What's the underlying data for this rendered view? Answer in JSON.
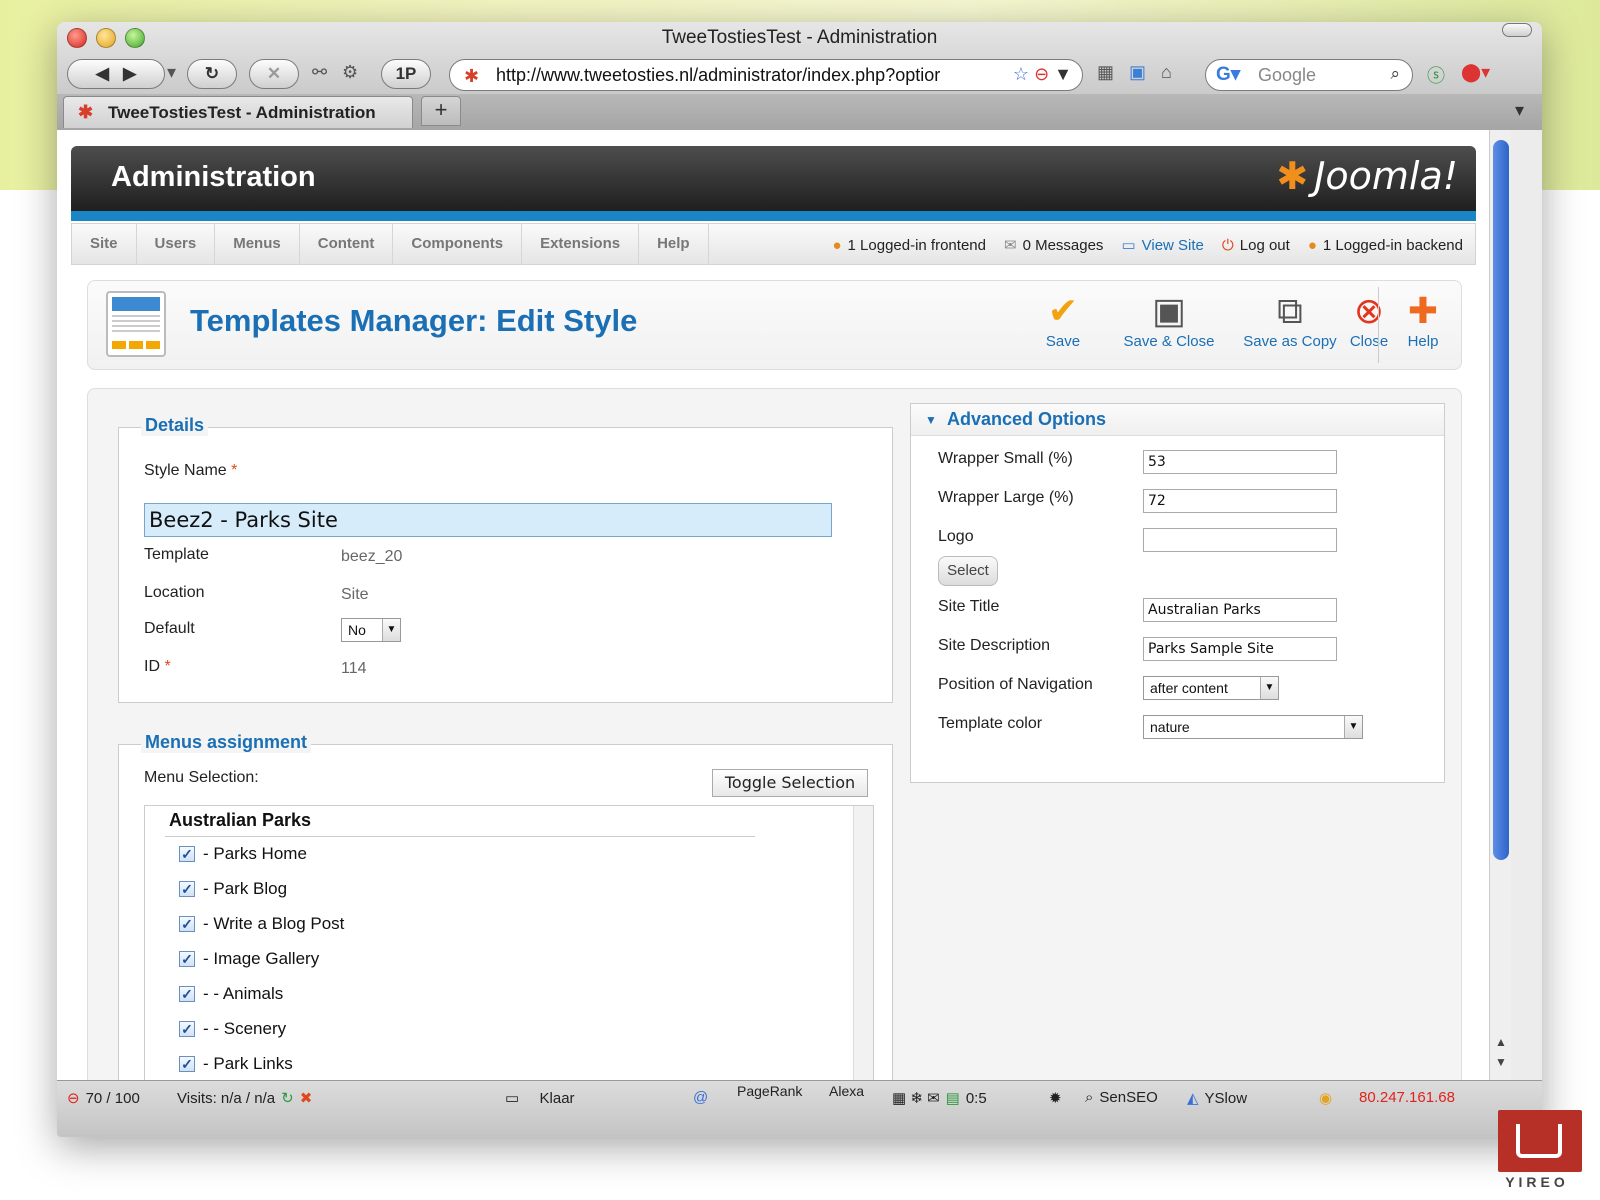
{
  "window": {
    "title": "TweeTostiesTest - Administration"
  },
  "browser": {
    "url": "http://www.tweetosties.nl/administrator/index.php?optior",
    "search_placeholder": "Google",
    "tab_title": "TweeTostiesTest - Administration",
    "new_tab": "+",
    "onep_label": "1P"
  },
  "header": {
    "title": "Administration",
    "logo": "Joomla!"
  },
  "menu": {
    "items": [
      "Site",
      "Users",
      "Menus",
      "Content",
      "Components",
      "Extensions",
      "Help"
    ],
    "status": {
      "frontend": "1 Logged-in frontend",
      "messages": "0 Messages",
      "view_site": "View Site",
      "logout": "Log out",
      "backend": "1 Logged-in backend"
    }
  },
  "toolbar": {
    "title": "Templates Manager: Edit Style",
    "save": "Save",
    "save_close": "Save & Close",
    "save_copy": "Save as Copy",
    "close": "Close",
    "help": "Help"
  },
  "details": {
    "legend": "Details",
    "style_name_label": "Style Name",
    "required_mark": "*",
    "style_name_value": "Beez2 - Parks Site",
    "template_label": "Template",
    "template_value": "beez_20",
    "location_label": "Location",
    "location_value": "Site",
    "default_label": "Default",
    "default_value": "No",
    "id_label": "ID",
    "id_value": "114"
  },
  "menus_assignment": {
    "legend": "Menus assignment",
    "menu_selection_label": "Menu Selection:",
    "toggle_button": "Toggle Selection",
    "group_title": "Australian Parks",
    "entries": [
      "- Parks Home",
      "- Park Blog",
      "- Write a Blog Post",
      "- Image Gallery",
      "- - Animals",
      "- - Scenery",
      "- Park Links"
    ]
  },
  "advanced": {
    "header": "Advanced Options",
    "wrapper_small_label": "Wrapper Small (%)",
    "wrapper_small_value": "53",
    "wrapper_large_label": "Wrapper Large (%)",
    "wrapper_large_value": "72",
    "logo_label": "Logo",
    "logo_value": "",
    "select_button": "Select",
    "site_title_label": "Site Title",
    "site_title_value": "Australian Parks",
    "site_desc_label": "Site Description",
    "site_desc_value": "Parks Sample Site",
    "nav_position_label": "Position of Navigation",
    "nav_position_value": "after content",
    "template_color_label": "Template color",
    "template_color_value": "nature"
  },
  "statusbar": {
    "score": "70 / 100",
    "visits": "Visits: n/a / n/a",
    "state": "Klaar",
    "pagerank": "PageRank",
    "alexa": "Alexa",
    "ratio": "0:5",
    "senseo": "SenSEO",
    "yslow": "YSlow",
    "ip": "80.247.161.68"
  },
  "brand": {
    "text": "YIREO"
  },
  "colors": {
    "accent_blue": "#1a6fb5",
    "header_stripe": "#1a86c6",
    "style_input_bg": "#d7ecfb",
    "ip_red": "#e0231b"
  }
}
